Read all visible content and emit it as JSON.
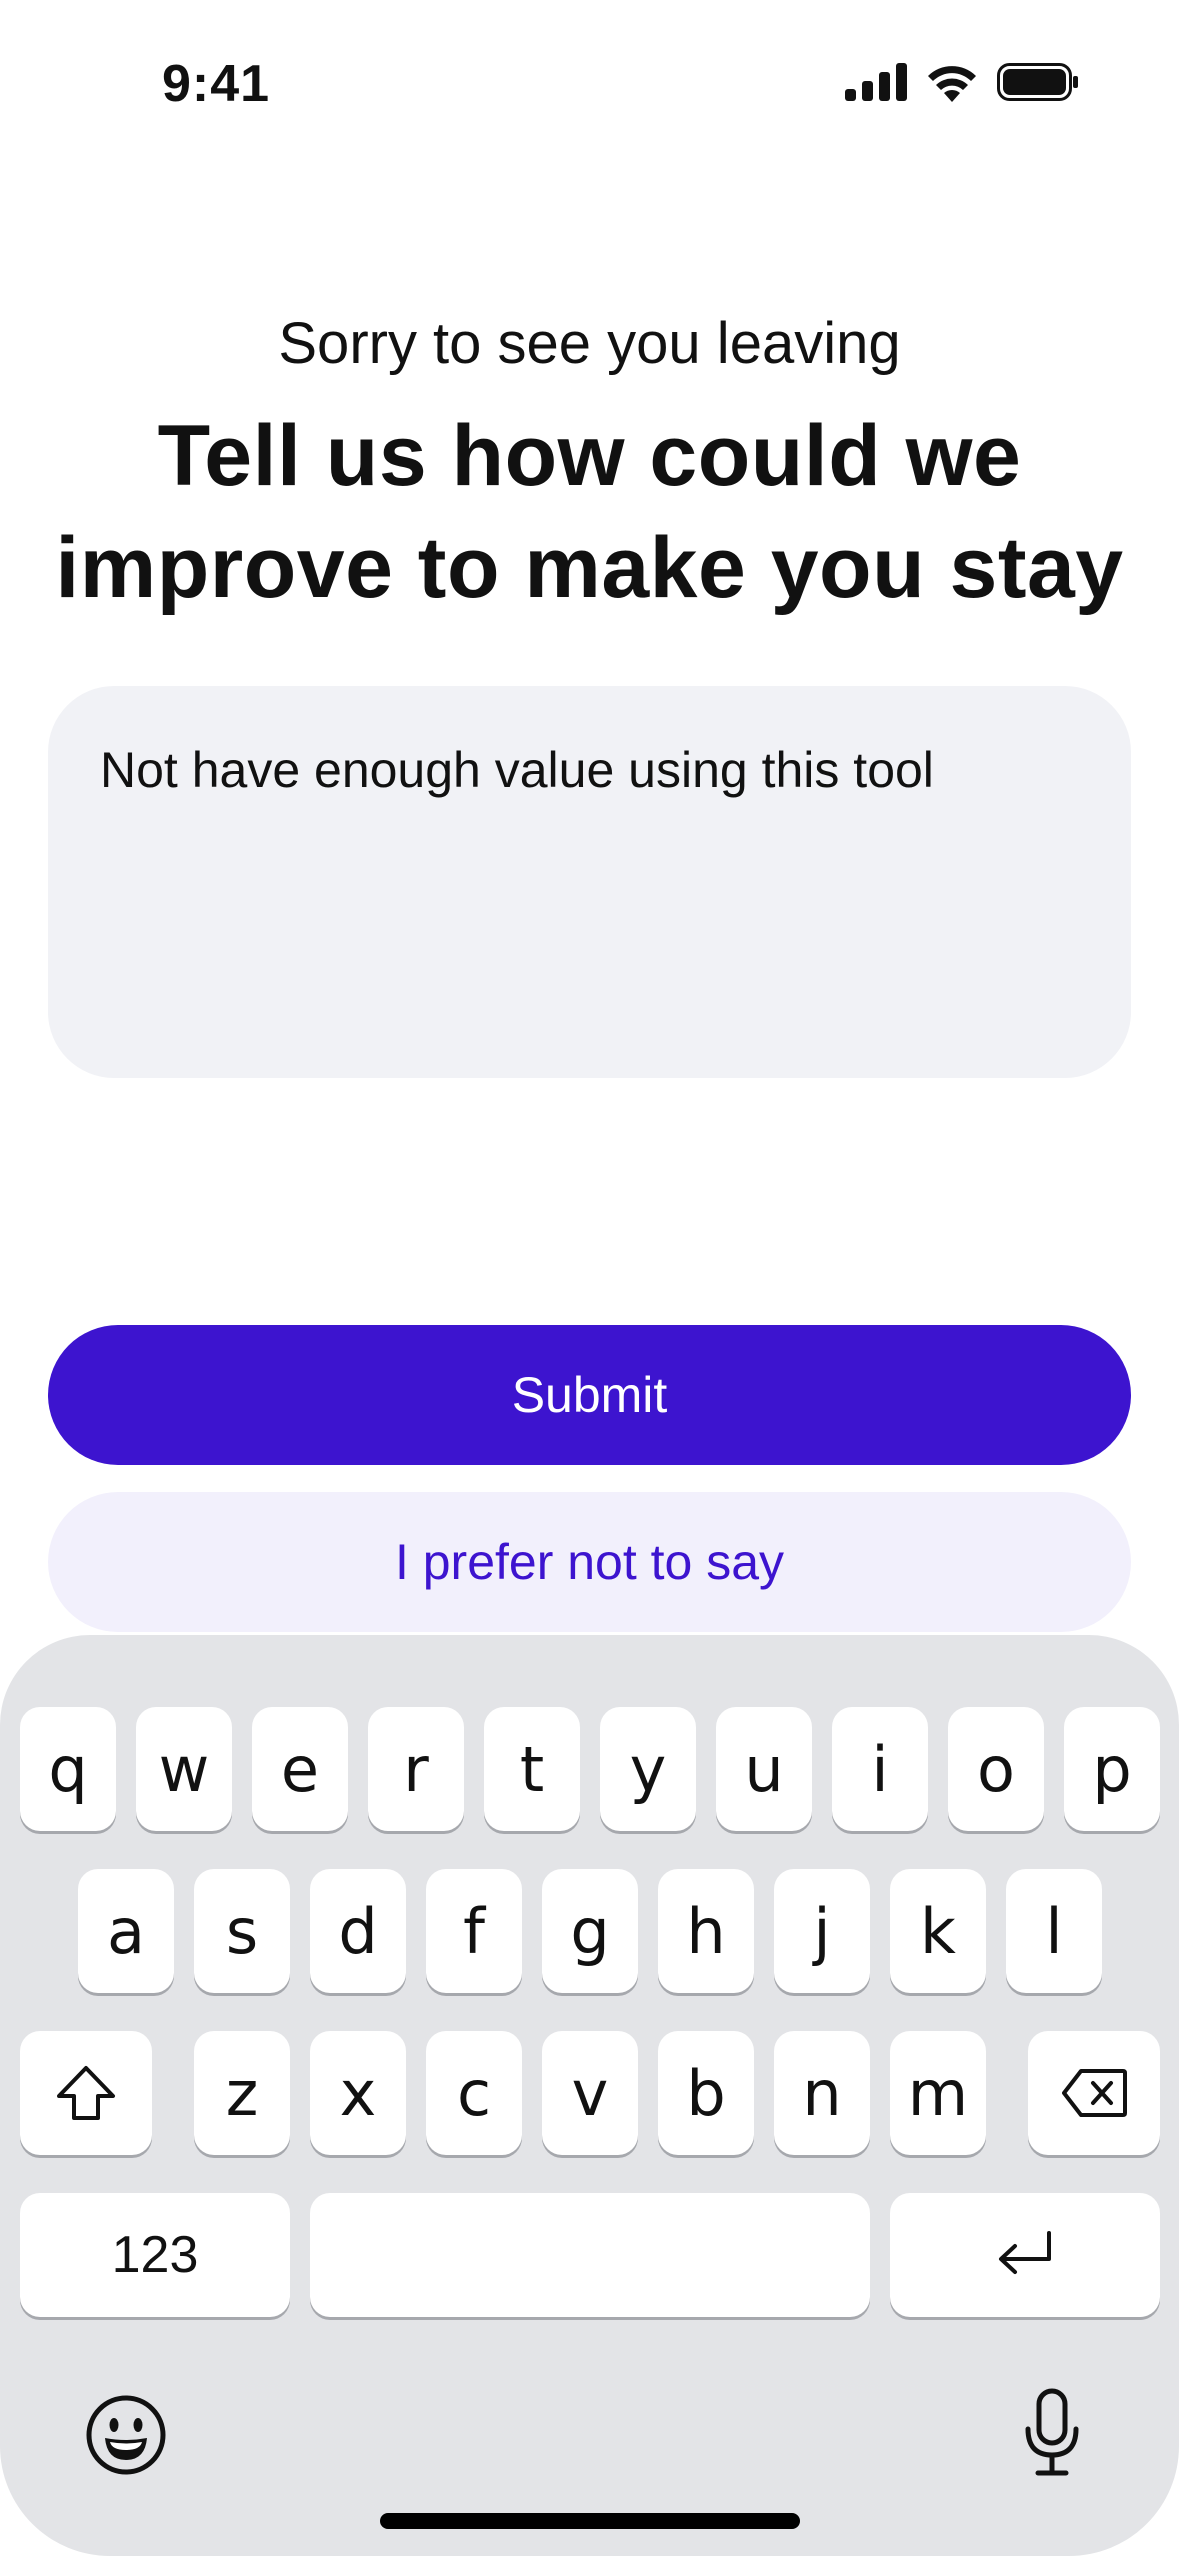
{
  "status_bar": {
    "time": "9:41",
    "icons": [
      "signal-icon",
      "wifi-icon",
      "battery-icon"
    ]
  },
  "header": {
    "subtitle": "Sorry to see you leaving",
    "title": "Tell us how could we improve to make you stay"
  },
  "feedback": {
    "value": "Not have enough value using this tool"
  },
  "actions": {
    "submit_label": "Submit",
    "skip_label": "I prefer not to say"
  },
  "keyboard": {
    "row1": [
      "q",
      "w",
      "e",
      "r",
      "t",
      "y",
      "u",
      "i",
      "o",
      "p"
    ],
    "row2": [
      "a",
      "s",
      "d",
      "f",
      "g",
      "h",
      "j",
      "k",
      "l"
    ],
    "row3": [
      "z",
      "x",
      "c",
      "v",
      "b",
      "n",
      "m"
    ],
    "numbers_label": "123",
    "icons": [
      "shift-icon",
      "backspace-icon",
      "return-icon",
      "emoji-icon",
      "microphone-icon"
    ]
  },
  "colors": {
    "primary": "#3d14cf",
    "secondary_bg": "#f2f0fc",
    "field_bg": "#f1f2f6",
    "keyboard_bg": "#e3e4e7"
  }
}
